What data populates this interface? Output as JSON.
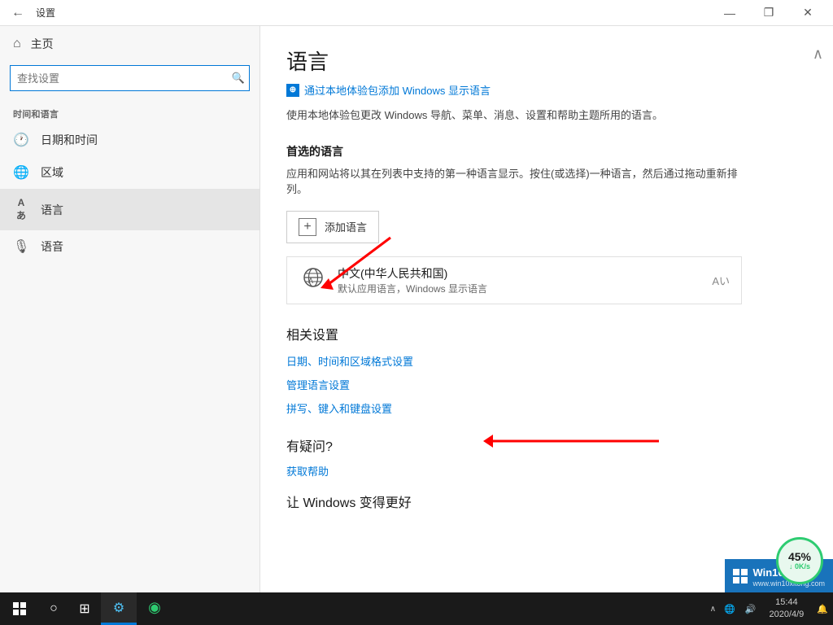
{
  "window": {
    "title": "设置",
    "controls": {
      "minimize": "—",
      "restore": "❐",
      "close": "✕"
    }
  },
  "sidebar": {
    "back_label": "←",
    "title": "设置",
    "home_label": "主页",
    "search_placeholder": "查找设置",
    "section_label": "时间和语言",
    "nav_items": [
      {
        "id": "datetime",
        "label": "日期和时间",
        "icon": "🕐"
      },
      {
        "id": "region",
        "label": "区域",
        "icon": "🌐"
      },
      {
        "id": "language",
        "label": "语言",
        "icon": "Aあ",
        "active": true
      },
      {
        "id": "speech",
        "label": "语音",
        "icon": "🎙"
      }
    ]
  },
  "content": {
    "page_title": "语言",
    "add_windows_display_link": "通过本地体验包添加 Windows 显示语言",
    "description": "使用本地体验包更改 Windows 导航、菜单、消息、设置和帮助主题所用的语言。",
    "preferred_section_title": "首选的语言",
    "preferred_section_desc": "应用和网站将以其在列表中支持的第一种语言显示。按住(或选择)一种语言，然后通过拖动重新排列。",
    "add_language_btn": "添加语言",
    "languages": [
      {
        "name": "中文(中华人民共和国)",
        "desc": "默认应用语言，Windows 显示语言"
      }
    ],
    "related_title": "相关设置",
    "related_links": [
      "日期、时间和区域格式设置",
      "管理语言设置",
      "拼写、键入和键盘设置"
    ],
    "help_title": "有疑问?",
    "get_help_label": "获取帮助",
    "improve_title": "让 Windows 变得更好"
  },
  "taskbar": {
    "clock_time": "15:44",
    "clock_date": "2020/4/9",
    "chevron_label": "∧"
  },
  "speed_meter": {
    "percent": "45%",
    "rate": "↓ 0K/s"
  },
  "branding": {
    "name": "Win10 之家",
    "url": "www.win10xitong.com"
  },
  "taskbar_tray": {
    "chevron": "∧"
  }
}
